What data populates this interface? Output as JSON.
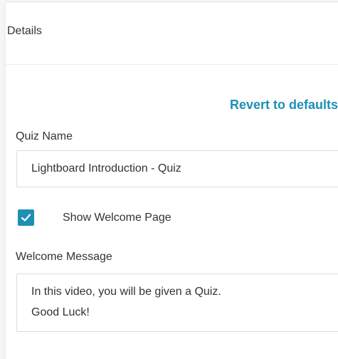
{
  "details": {
    "title": "Details",
    "revert_label": "Revert to defaults"
  },
  "quiz_name": {
    "label": "Quiz Name",
    "value": "Lightboard Introduction - Quiz"
  },
  "welcome_page": {
    "label": "Show Welcome Page",
    "checked": true
  },
  "welcome_message": {
    "label": "Welcome Message",
    "value": "In this video, you will be given a Quiz.\nGood Luck!"
  },
  "colors": {
    "accent": "#1e8fb5",
    "text": "#333333",
    "border": "#dcdcdc"
  }
}
